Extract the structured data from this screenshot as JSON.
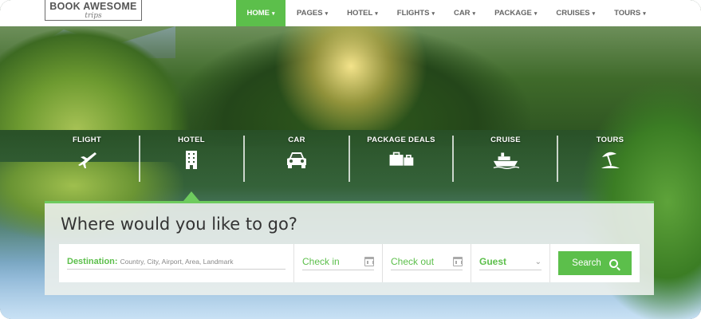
{
  "logo": {
    "main": "BOOK AWESOME",
    "sub": "trips"
  },
  "nav": [
    {
      "label": "HOME",
      "active": true
    },
    {
      "label": "PAGES",
      "active": false
    },
    {
      "label": "HOTEL",
      "active": false
    },
    {
      "label": "FLIGHTS",
      "active": false
    },
    {
      "label": "CAR",
      "active": false
    },
    {
      "label": "PACKAGE",
      "active": false
    },
    {
      "label": "CRUISES",
      "active": false
    },
    {
      "label": "TOURS",
      "active": false
    }
  ],
  "caret": "▾",
  "tabs": [
    {
      "label": "FLIGHT",
      "icon": "airplane-icon"
    },
    {
      "label": "HOTEL",
      "icon": "building-icon"
    },
    {
      "label": "CAR",
      "icon": "car-icon"
    },
    {
      "label": "PACKAGE DEALS",
      "icon": "luggage-icon"
    },
    {
      "label": "CRUISE",
      "icon": "ship-icon"
    },
    {
      "label": "TOURS",
      "icon": "beach-umbrella-icon"
    }
  ],
  "search": {
    "title": "Where would you like to go?",
    "destination_label": "Destination:",
    "destination_placeholder": "Country, City, Airport, Area, Landmark",
    "checkin": "Check in",
    "checkout": "Check out",
    "guest": "Guest",
    "button": "Search"
  },
  "colors": {
    "accent": "#5cbf4b",
    "text_dark": "#333333"
  }
}
